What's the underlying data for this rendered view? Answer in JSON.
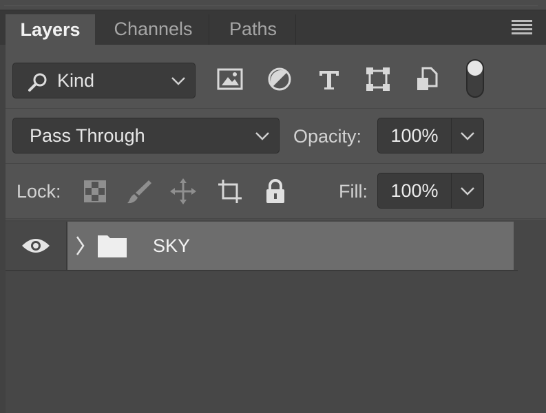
{
  "tabs": [
    {
      "label": "Layers",
      "active": true
    },
    {
      "label": "Channels",
      "active": false
    },
    {
      "label": "Paths",
      "active": false
    }
  ],
  "panel_menu_icon": "hamburger-menu-icon",
  "filter": {
    "kind_label": "Kind",
    "icons": [
      "image-filter-icon",
      "adjustment-filter-icon",
      "type-filter-icon",
      "shape-filter-icon",
      "smart-object-filter-icon",
      "filter-toggle-icon"
    ]
  },
  "blend": {
    "mode": "Pass Through",
    "opacity_label": "Opacity:",
    "opacity_value": "100%"
  },
  "lock": {
    "label": "Lock:",
    "icons": [
      "lock-transparent-pixels-icon",
      "lock-image-pixels-icon",
      "lock-position-icon",
      "lock-artboard-icon",
      "lock-all-icon"
    ],
    "fill_label": "Fill:",
    "fill_value": "100%"
  },
  "layers": [
    {
      "name": "SKY",
      "type": "group",
      "visible": true,
      "expanded": false,
      "selected": true
    }
  ],
  "colors": {
    "panel_bg": "#535353",
    "tabbar_bg": "#383838",
    "field_bg": "#3b3b3b",
    "selected_layer": "#6d6d6d",
    "icon": "#d8d8d8"
  }
}
